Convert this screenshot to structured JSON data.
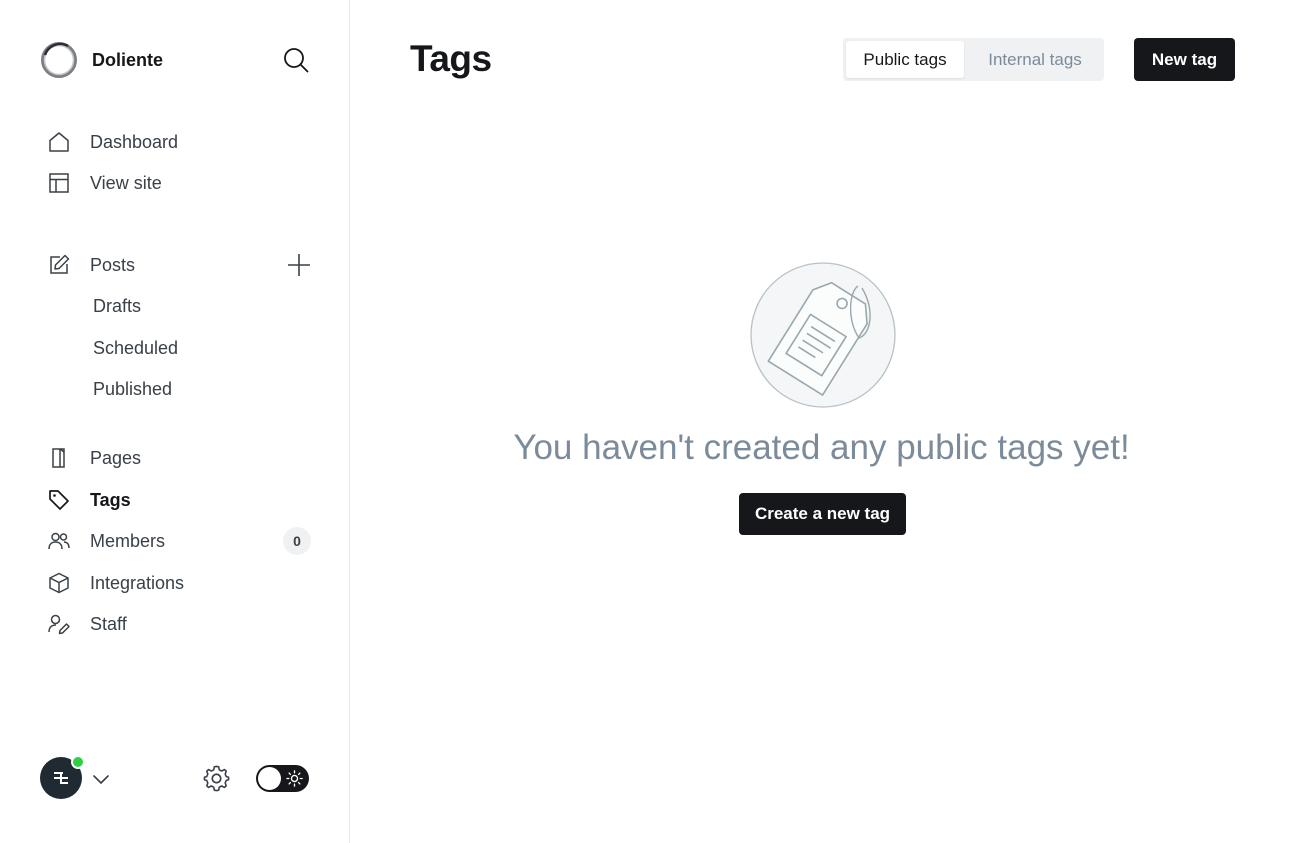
{
  "brand": {
    "name": "Doliente",
    "logo_icon": "circle-ring-logo"
  },
  "search": {
    "icon": "search-icon"
  },
  "nav": {
    "primary": [
      {
        "label": "Dashboard",
        "icon": "home-icon"
      },
      {
        "label": "View site",
        "icon": "layout-icon"
      }
    ],
    "posts": {
      "label": "Posts",
      "icon": "edit-icon",
      "add_icon": "plus-icon",
      "sub_items": [
        "Drafts",
        "Scheduled",
        "Published"
      ]
    },
    "secondary": [
      {
        "label": "Pages",
        "icon": "page-icon"
      },
      {
        "label": "Tags",
        "icon": "tag-icon",
        "active": true
      },
      {
        "label": "Members",
        "icon": "members-icon",
        "badge": "0"
      },
      {
        "label": "Integrations",
        "icon": "cube-icon"
      },
      {
        "label": "Staff",
        "icon": "staff-icon"
      }
    ]
  },
  "footer": {
    "status_color": "#30cf43",
    "avatar_bg": "#1f2a33",
    "theme_toggle": "dark"
  },
  "header": {
    "title": "Tags",
    "tabs": [
      {
        "label": "Public tags",
        "active": true
      },
      {
        "label": "Internal tags",
        "active": false
      }
    ],
    "new_button": "New tag"
  },
  "empty_state": {
    "message": "You haven't created any public tags yet!",
    "button": "Create a new tag",
    "illustration": "tag-illustration"
  },
  "colors": {
    "primary_dark": "#15171a",
    "muted_text": "#7c8b9a",
    "nav_text": "#394047",
    "tab_bg": "#eff1f3"
  }
}
